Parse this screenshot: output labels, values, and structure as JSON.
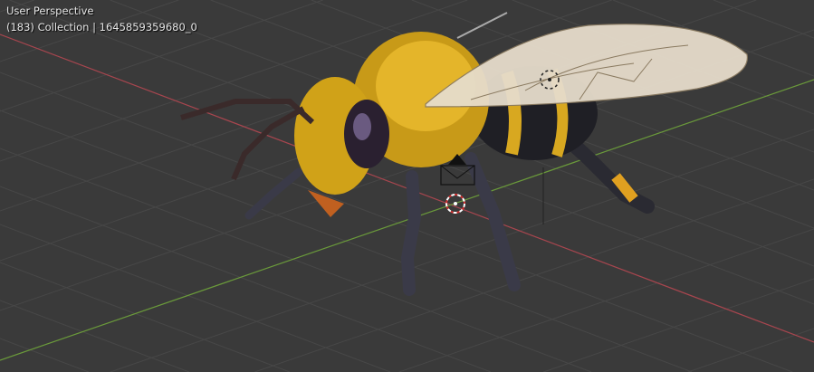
{
  "viewport": {
    "view_label": "User Perspective",
    "collection_label": "(183) Collection | 1645859359680_0"
  },
  "colors": {
    "background": "#3a3a3a",
    "grid": "#4a4a4a",
    "x_axis": "#a8454e",
    "y_axis": "#6a9a3a",
    "body_yellow": "#e0b020",
    "body_dark": "#2a2a30"
  },
  "icons": [
    "3d-cursor-icon",
    "camera-icon",
    "object-origin-icon"
  ]
}
